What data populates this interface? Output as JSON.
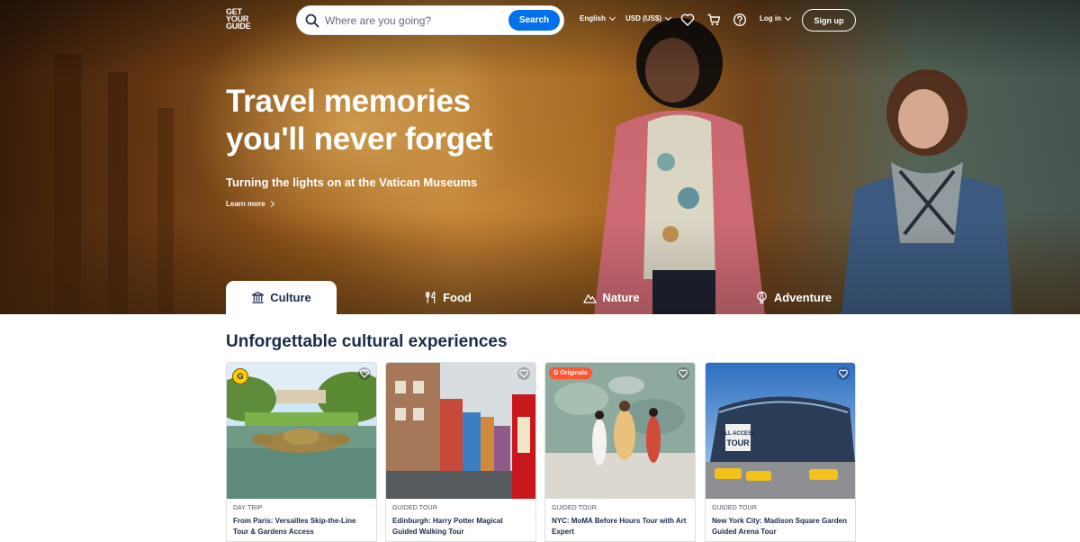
{
  "header": {
    "logo_lines": [
      "GET",
      "YOUR",
      "GUIDE"
    ],
    "search_placeholder": "Where are you going?",
    "search_button": "Search",
    "language": "English",
    "currency": "USD (US$)",
    "login": "Log in",
    "signup": "Sign up",
    "icons": [
      "search-icon",
      "heart-icon",
      "cart-icon",
      "help-icon"
    ]
  },
  "hero": {
    "title_line1": "Travel memories",
    "title_line2": "you'll never forget",
    "subtitle": "Turning the lights on at the Vatican Museums",
    "learn_more": "Learn more"
  },
  "tabs": [
    {
      "label": "Culture",
      "icon": "museum-icon",
      "active": true
    },
    {
      "label": "Food",
      "icon": "fork-knife-icon",
      "active": false
    },
    {
      "label": "Nature",
      "icon": "mountain-icon",
      "active": false
    },
    {
      "label": "Adventure",
      "icon": "balloon-icon",
      "active": false
    }
  ],
  "section": {
    "title": "Unforgettable cultural experiences",
    "cards": [
      {
        "category": "DAY TRIP",
        "title": "From Paris: Versailles Skip-the-Line Tour & Gardens Access",
        "badge": "G"
      },
      {
        "category": "GUIDED TOUR",
        "title": "Edinburgh: Harry Potter Magical Guided Walking Tour",
        "badge": ""
      },
      {
        "category": "GUIDED TOUR",
        "title": "NYC: MoMA Before Hours Tour with Art Expert",
        "badge": "G Originals"
      },
      {
        "category": "GUIDED TOUR",
        "title": "New York City: Madison Square Garden Guided Arena Tour",
        "badge": ""
      }
    ],
    "card4_sign": [
      "ALL ACCESS",
      "TOUR"
    ]
  },
  "colors": {
    "brand_blue": "#0071eb",
    "text_dark": "#1a2b49",
    "originals_orange": "#ff5533"
  }
}
